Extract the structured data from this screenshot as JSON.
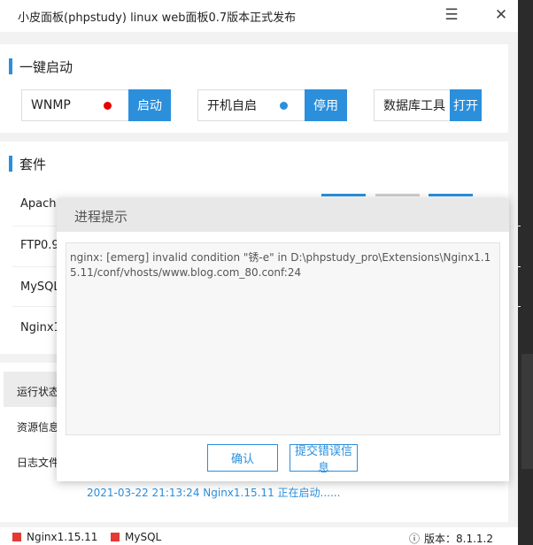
{
  "window": {
    "title": "小皮面板(phpstudy) linux web面板0.7版本正式发布",
    "menu_icon": "hamburger-icon",
    "close_icon": "close-icon",
    "menu_glyph": "☰",
    "close_glyph": "✕"
  },
  "quick_start": {
    "title": "一键启动",
    "groups": [
      {
        "label": "WNMP",
        "status_color": "#e60000",
        "action": "启动"
      },
      {
        "label": "开机自启",
        "status_color": "#2b8fdc",
        "action": "停用"
      },
      {
        "label": "数据库工具",
        "action": "打开"
      }
    ]
  },
  "suite": {
    "title": "套件",
    "rows": [
      "Apache",
      "FTP0.9.",
      "MySQL",
      "Nginx1"
    ]
  },
  "side_tabs": [
    "运行状态",
    "资源信息",
    "日志文件"
  ],
  "log": {
    "lines": [
      "2021-03-22 21:13:24 Nginx1.15.11 正在启动......"
    ]
  },
  "status_bar": {
    "services": [
      "Nginx1.15.11",
      "MySQL"
    ],
    "version_label": "版本：8.1.1.2",
    "info_glyph": "ⓘ"
  },
  "modal": {
    "title": "进程提示",
    "message": "nginx: [emerg] invalid condition \"锈-e\" in D:\\phpstudy_pro\\Extensions\\Nginx1.15.11/conf/vhosts/www.blog.com_80.conf:24",
    "confirm_label": "确认",
    "report_label": "提交错误信息"
  }
}
